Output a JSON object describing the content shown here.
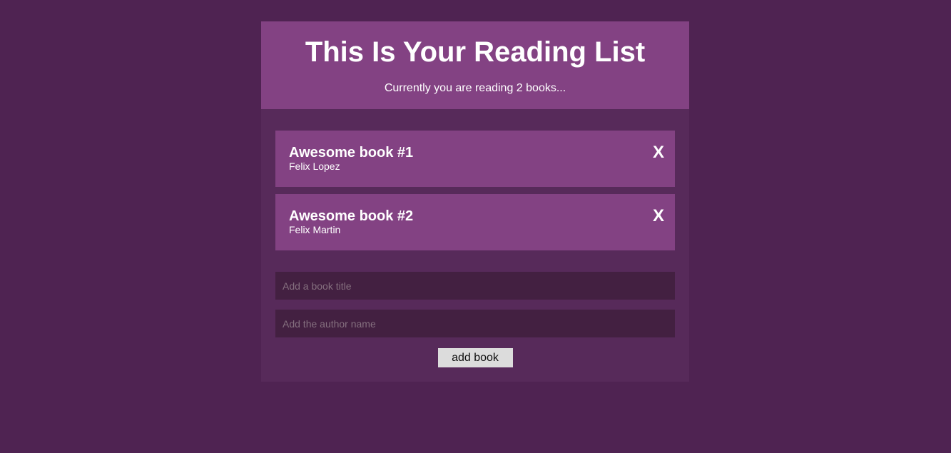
{
  "header": {
    "title": "This Is Your Reading List",
    "subtitle": "Currently you are reading 2 books..."
  },
  "books": [
    {
      "title": "Awesome book #1",
      "author": "Felix Lopez",
      "delete_label": "X"
    },
    {
      "title": "Awesome book #2",
      "author": "Felix Martin",
      "delete_label": "X"
    }
  ],
  "form": {
    "title_placeholder": "Add a book title",
    "title_value": "",
    "author_placeholder": "Add the author name",
    "author_value": "",
    "submit_label": "add book"
  },
  "colors": {
    "page_background": "#4f2352",
    "panel_background": "#572a5a",
    "accent": "#834283",
    "input_background": "#432041",
    "button_background": "#dcdcdc"
  }
}
